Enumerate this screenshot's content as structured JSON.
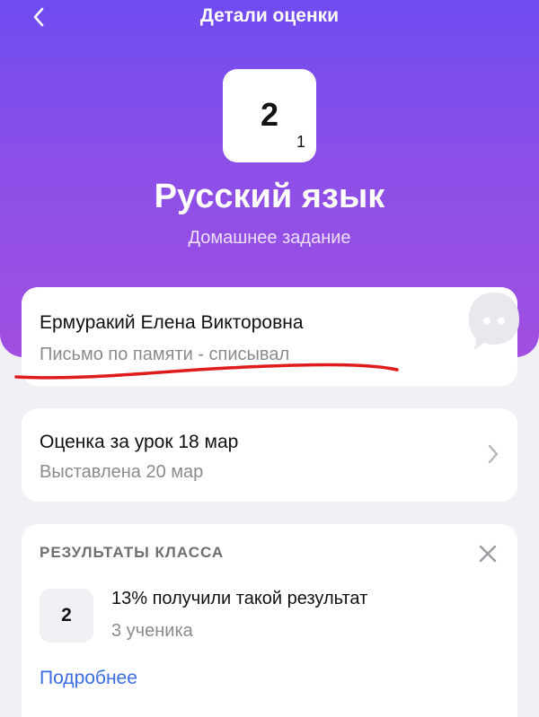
{
  "header": {
    "title": "Детали оценки",
    "back_icon": "chevron-left-icon"
  },
  "grade": {
    "value": "2",
    "weight": "1"
  },
  "subject": "Русский язык",
  "work_type": "Домашнее задание",
  "teacher": {
    "name": "Ермуракий Елена Викторовна",
    "comment": "Письмо по памяти - списывал",
    "chat_icon": "chat-bubble-icon"
  },
  "lesson": {
    "title": "Оценка за урок 18 мар",
    "set_date": "Выставлена 20 мар",
    "chevron_icon": "chevron-right-icon"
  },
  "class_results": {
    "header": "РЕЗУЛЬТАТЫ КЛАССА",
    "close_icon": "close-icon",
    "grade": "2",
    "percent_text": "13% получили такой результат",
    "students_text": "3 ученика",
    "more_link": "Подробнее"
  },
  "colors": {
    "accent_top": "#6f4cf0",
    "accent_bottom": "#a04fe0",
    "link": "#3b6ce0",
    "annotation": "#e01b1b"
  }
}
